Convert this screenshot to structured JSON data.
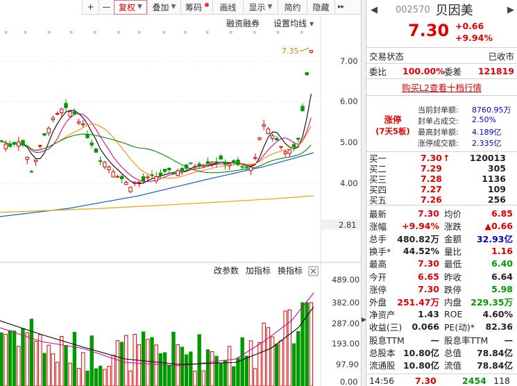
{
  "toolbar": {
    "plus": "+",
    "minus": "—",
    "fuquan": "复权",
    "diejia": "叠加",
    "chouma": "筹码",
    "huaxian": "画线",
    "xianshi": "显示",
    "jianyue": "简约",
    "yincang": "隐藏",
    "more": "▸▸"
  },
  "chart": {
    "rzrq": "融资融券",
    "set_ma": "设置均线",
    "high_label": "7.35",
    "price_ticks": [
      "7.00",
      "6.00",
      "5.00",
      "4.00"
    ],
    "low_label": "2.81",
    "vol_buttons": {
      "modify": "改参数",
      "add": "加指标",
      "switch": "换指标"
    },
    "vol_ticks": [
      "489.00",
      "382.00",
      "287.00",
      "193.00",
      "97.90",
      "0.00"
    ]
  },
  "stock": {
    "nav_prev": "◀",
    "nav_next": "▶",
    "code": "002570",
    "name": "贝因美",
    "price": "7.30",
    "change": "+0.66",
    "pct": "+9.94%"
  },
  "status": {
    "label": "交易状态",
    "value": "已收市"
  },
  "weibi": {
    "label": "委比",
    "value": "100.00%",
    "diff_label": "委差",
    "diff": "121819"
  },
  "l2_link": "购买L2查看十档行情",
  "limit_up": {
    "badge": "涨停",
    "badge_sub": "(7天5板)",
    "items": [
      {
        "label": "当前封单额:",
        "value": "8760.95万"
      },
      {
        "label": "封单占成交:",
        "value": "2.50%"
      },
      {
        "label": "最高封单额:",
        "value": "4.189亿"
      },
      {
        "label": "涨停成交额:",
        "value": "2.335亿"
      }
    ]
  },
  "orderbook": [
    {
      "label": "买一",
      "price": "7.30",
      "arrow": "↑",
      "vol": "120013"
    },
    {
      "label": "买二",
      "price": "7.29",
      "arrow": "",
      "vol": "305"
    },
    {
      "label": "买三",
      "price": "7.28",
      "arrow": "",
      "vol": "1136"
    },
    {
      "label": "买四",
      "price": "7.27",
      "arrow": "",
      "vol": "109"
    },
    {
      "label": "买五",
      "price": "7.26",
      "arrow": "",
      "vol": "256"
    }
  ],
  "quote": [
    {
      "l1": "最新",
      "v1": "7.30",
      "c1": "red",
      "l2": "均价",
      "v2": "6.85",
      "c2": "red"
    },
    {
      "l1": "涨幅",
      "v1": "+9.94%",
      "c1": "red",
      "l2": "涨跌",
      "v2": "▲0.66",
      "c2": "red"
    },
    {
      "l1": "总手",
      "v1": "480.82万",
      "c1": "black",
      "l2": "金额",
      "v2": "32.93亿",
      "c2": "blue"
    },
    {
      "l1": "换手*",
      "v1": "44.52%",
      "c1": "black",
      "l2": "量比",
      "v2": "1.16",
      "c2": "red"
    },
    {
      "l1": "最高",
      "v1": "7.30",
      "c1": "red",
      "l2": "最低",
      "v2": "6.40",
      "c2": "green"
    },
    {
      "l1": "今开",
      "v1": "6.65",
      "c1": "red",
      "l2": "昨收",
      "v2": "6.64",
      "c2": "black"
    },
    {
      "l1": "涨停",
      "v1": "7.30",
      "c1": "red",
      "l2": "跌停",
      "v2": "5.98",
      "c2": "green"
    },
    {
      "l1": "外盘",
      "v1": "251.47万",
      "c1": "red",
      "l2": "内盘",
      "v2": "229.35万",
      "c2": "green"
    },
    {
      "l1": "净资产",
      "v1": "1.43",
      "c1": "black",
      "l2": "ROE",
      "v2": "4.60%",
      "c2": "black"
    },
    {
      "l1": "收益(三)",
      "v1": "0.066",
      "c1": "black",
      "l2": "PE(动)*",
      "v2": "82.36",
      "c2": "black"
    },
    {
      "l1": "股息TTM",
      "v1": "—",
      "c1": "black",
      "l2": "股息率TTM",
      "v2": "—",
      "c2": "black"
    },
    {
      "l1": "总股本",
      "v1": "10.80亿",
      "c1": "black",
      "l2": "总值",
      "v2": "78.84亿",
      "c2": "black"
    },
    {
      "l1": "流通股",
      "v1": "10.80亿",
      "c1": "black",
      "l2": "流值",
      "v2": "78.84亿",
      "c2": "black"
    }
  ],
  "tick": {
    "time": "14:56",
    "price": "7.30",
    "vol": "2454",
    "count": "118"
  },
  "colors": {
    "up": "#e00000",
    "down": "#009900",
    "ma5": "#000000",
    "ma10": "#e0009e",
    "ma20": "#ff8c00",
    "ma60": "#008800",
    "ma120": "#1e5fd0",
    "ma250": "#e6a800"
  }
}
